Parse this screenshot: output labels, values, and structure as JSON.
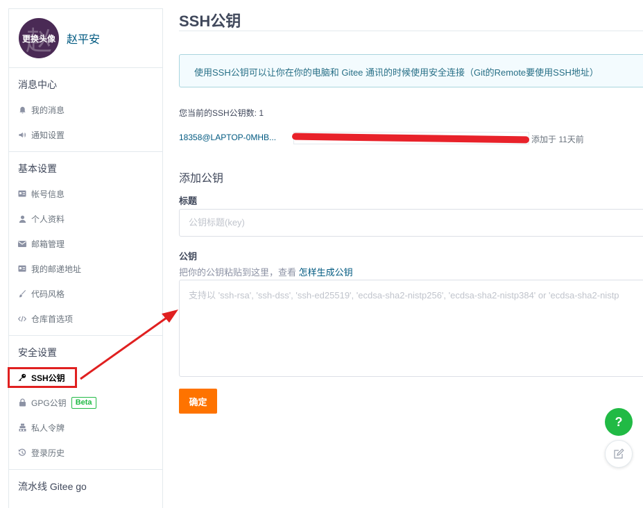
{
  "profile": {
    "avatar_char": "赵",
    "avatar_change": "更换头像",
    "name": "赵平安"
  },
  "sidebar": {
    "sections": [
      {
        "title": "消息中心",
        "items": [
          {
            "icon": "bell-icon",
            "label": "我的消息"
          },
          {
            "icon": "speaker-icon",
            "label": "通知设置"
          }
        ]
      },
      {
        "title": "基本设置",
        "items": [
          {
            "icon": "id-card-icon",
            "label": "帐号信息"
          },
          {
            "icon": "user-icon",
            "label": "个人资料"
          },
          {
            "icon": "mail-icon",
            "label": "邮箱管理"
          },
          {
            "icon": "id-card-icon",
            "label": "我的邮递地址"
          },
          {
            "icon": "brush-icon",
            "label": "代码风格"
          },
          {
            "icon": "code-icon",
            "label": "仓库首选项"
          }
        ]
      },
      {
        "title": "安全设置",
        "items": [
          {
            "icon": "key-icon",
            "label": "SSH公钥",
            "active": true
          },
          {
            "icon": "lock-icon",
            "label": "GPG公钥",
            "badge": "Beta"
          },
          {
            "icon": "token-icon",
            "label": "私人令牌"
          },
          {
            "icon": "history-icon",
            "label": "登录历史"
          }
        ]
      },
      {
        "title": "流水线 Gitee go"
      }
    ]
  },
  "main": {
    "title": "SSH公钥",
    "info": "使用SSH公钥可以让你在你的电脑和 Gitee 通讯的时候使用安全连接（Git的Remote要使用SSH地址）",
    "key_count": "您当前的SSH公钥数: 1",
    "keys": [
      {
        "title": "18358@LAPTOP-0MHB...",
        "added": "添加于 11天前"
      }
    ],
    "add_heading": "添加公钥",
    "title_label": "标题",
    "title_placeholder": "公钥标题(key)",
    "key_label": "公钥",
    "key_hint": "把你的公钥粘贴到这里，查看",
    "key_hint_link": "怎样生成公钥",
    "key_placeholder": "支持以 'ssh-rsa', 'ssh-dss', 'ssh-ed25519', 'ecdsa-sha2-nistp256', 'ecdsa-sha2-nistp384' or 'ecdsa-sha2-nistp",
    "submit": "确定"
  },
  "fab": {
    "help": "?"
  },
  "colors": {
    "accent": "#fe7300",
    "link": "#005980",
    "help": "#21ba45",
    "annotation": "#e02020"
  }
}
